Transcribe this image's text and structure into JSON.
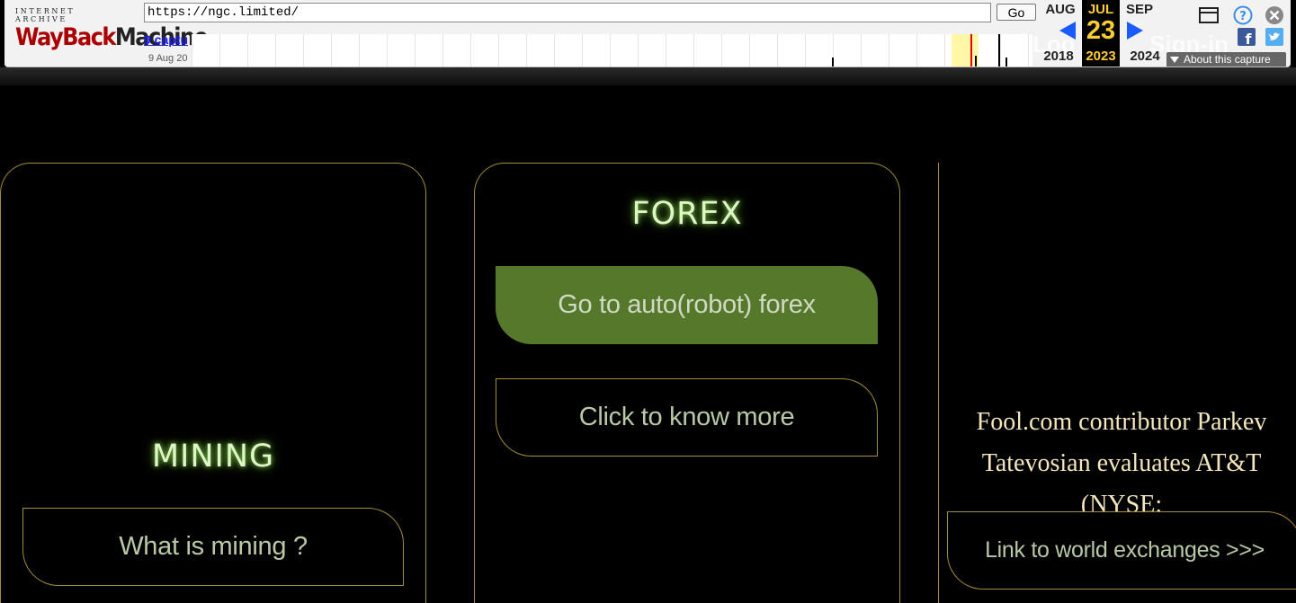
{
  "wayback": {
    "logo_top": "INTERNET ARCHIVE",
    "logo_main_wayback": "WayBack",
    "logo_main_machine": "Machine",
    "url": "https://ngc.limited/",
    "go_label": "Go",
    "captures_label": "9 captu",
    "date_range": "9 Aug 20",
    "prev_month": "AUG",
    "prev_year": "2018",
    "current_month": "JUL",
    "current_day": "23",
    "current_year": "2023",
    "next_month": "SEP",
    "next_year": "2024",
    "about_label": "About this capture",
    "ghost_login": "Log",
    "ghost_signin": "Sign-in"
  },
  "cards": {
    "mining_title": "MINING",
    "mining_button": "What is mining ?",
    "forex_title": "FOREX",
    "forex_button_primary": "Go to auto(robot) forex",
    "forex_button_secondary": "Click to know more"
  },
  "news": {
    "text": "Fool.com contributor Parkev Tatevosian evaluates AT&T (NYSE:",
    "link_button": "Link to world exchanges >>>"
  },
  "colors": {
    "accent_gold": "#a38c3a",
    "button_green": "#56782b",
    "glow_green": "#7bc043",
    "news_text": "#f4e7bd"
  }
}
